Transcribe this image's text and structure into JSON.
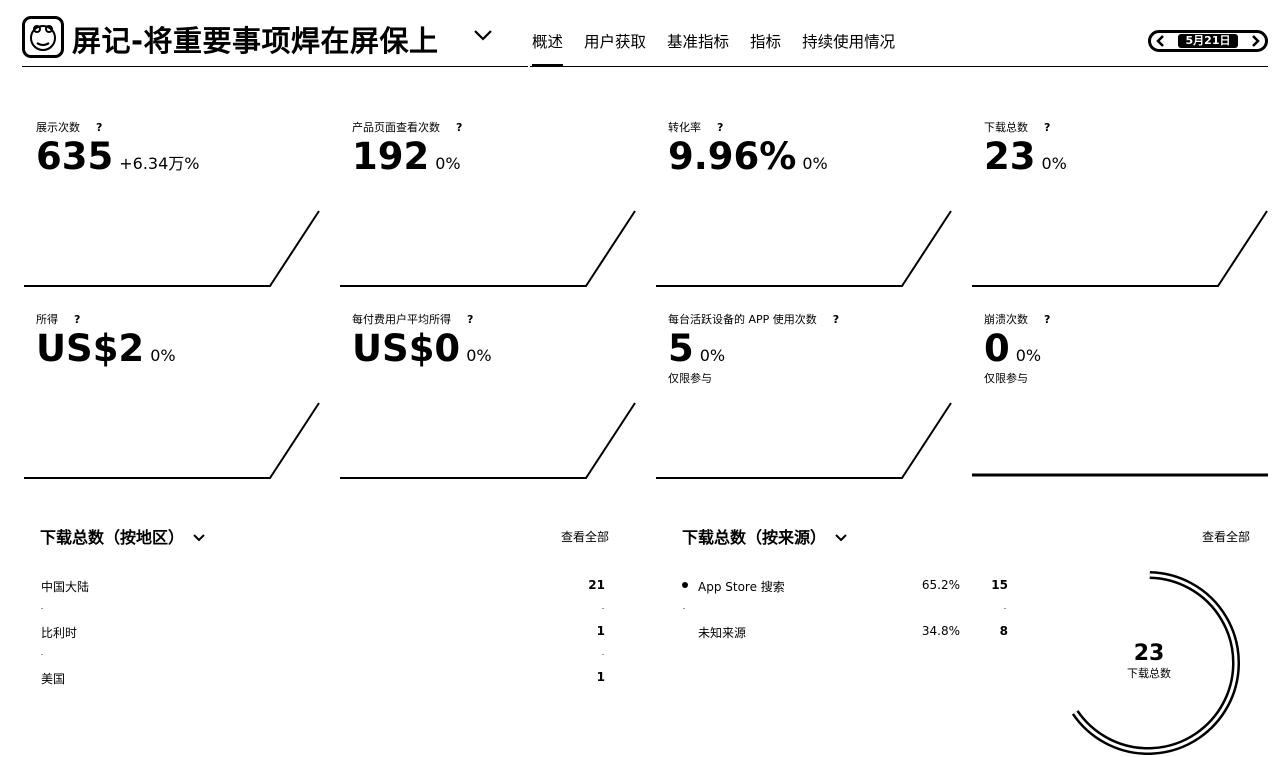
{
  "app": {
    "title": "屏记-将重要事项焊在屏保上",
    "icon": "app-face-icon"
  },
  "tabs": [
    "概述",
    "用户获取",
    "基准指标",
    "指标",
    "持续使用情况"
  ],
  "date": "5月21日",
  "metrics": [
    {
      "label": "展示次数",
      "help": "?",
      "value": "635",
      "change": "+6.34万%",
      "sub": ""
    },
    {
      "label": "产品页面查看次数",
      "help": "?",
      "value": "192",
      "change": "0%",
      "sub": ""
    },
    {
      "label": "转化率",
      "help": "?",
      "value": "9.96%",
      "change": "0%",
      "sub": ""
    },
    {
      "label": "下载总数",
      "help": "?",
      "value": "23",
      "change": "0%",
      "sub": ""
    },
    {
      "label": "所得",
      "help": "?",
      "value": "US$2",
      "change": "0%",
      "sub": ""
    },
    {
      "label": "每付费用户平均所得",
      "help": "?",
      "value": "US$0",
      "change": "0%",
      "sub": ""
    },
    {
      "label": "每台活跃设备的 APP 使用次数",
      "help": "?",
      "value": "5",
      "change": "0%",
      "sub": "仅限参与"
    },
    {
      "label": "崩溃次数",
      "help": "?",
      "value": "0",
      "change": "0%",
      "sub": "仅限参与"
    }
  ],
  "region": {
    "title": "下载总数（按地区）",
    "view_all": "查看全部",
    "rows": [
      {
        "label": "中国大陆",
        "value": "21"
      },
      {
        "label": "比利时",
        "value": "1"
      },
      {
        "label": "美国",
        "value": "1"
      }
    ]
  },
  "source": {
    "title": "下载总数（按来源）",
    "view_all": "查看全部",
    "rows": [
      {
        "label": "App Store 搜索",
        "pct": "65.2%",
        "value": "15"
      },
      {
        "label": "未知来源",
        "pct": "34.8%",
        "value": "8"
      }
    ],
    "total": "23",
    "total_label": "下载总数",
    "share": [
      0.652,
      0.348
    ]
  }
}
